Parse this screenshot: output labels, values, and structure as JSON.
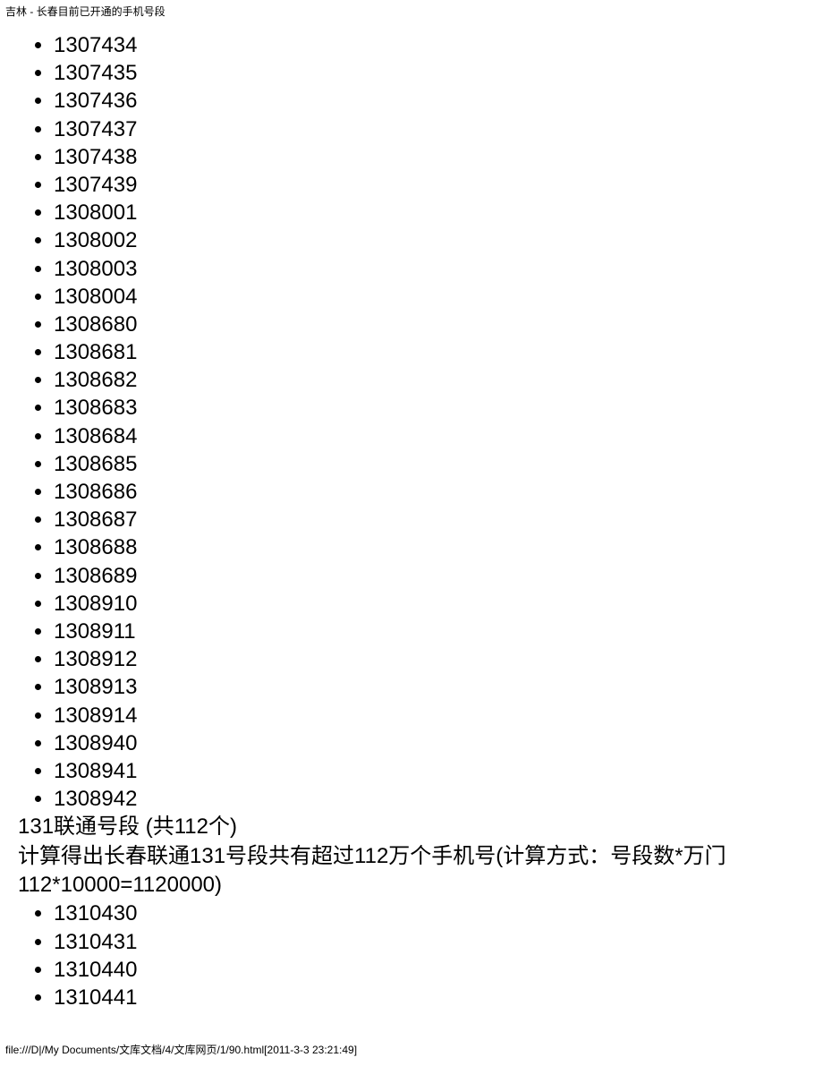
{
  "header": {
    "title": "吉林 - 长春目前已开通的手机号段"
  },
  "list1": [
    "1307434",
    "1307435",
    "1307436",
    "1307437",
    "1307438",
    "1307439",
    "1308001",
    "1308002",
    "1308003",
    "1308004",
    "1308680",
    "1308681",
    "1308682",
    "1308683",
    "1308684",
    "1308685",
    "1308686",
    "1308687",
    "1308688",
    "1308689",
    "1308910",
    "1308911",
    "1308912",
    "1308913",
    "1308914",
    "1308940",
    "1308941",
    "1308942"
  ],
  "section": {
    "line1": "131联通号段 (共112个)",
    "line2": "计算得出长春联通131号段共有超过112万个手机号(计算方式：号段数*万门 112*10000=1120000)"
  },
  "list2": [
    "1310430",
    "1310431",
    "1310440",
    "1310441"
  ],
  "footer": {
    "path": "file:///D|/My Documents/文库文档/4/文库网页/1/90.html[2011-3-3 23:21:49]"
  }
}
